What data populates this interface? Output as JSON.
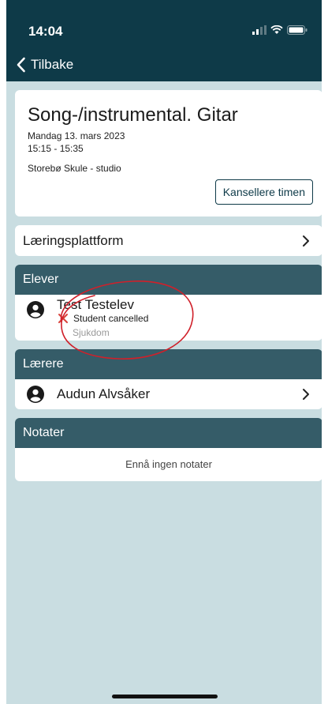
{
  "status_bar": {
    "time": "14:04"
  },
  "nav": {
    "back_label": "Tilbake"
  },
  "lesson": {
    "title": "Song-/instrumental. Gitar",
    "date": "Mandag 13. mars 2023",
    "time": "15:15 - 15:35",
    "location": "Storebø Skule - studio",
    "cancel_button": "Kansellere timen"
  },
  "platform": {
    "label": "Læringsplattform"
  },
  "students": {
    "heading": "Elever",
    "items": [
      {
        "name": "Test Testelev",
        "status": "Student cancelled",
        "reason": "Sjukdom"
      }
    ]
  },
  "teachers": {
    "heading": "Lærere",
    "items": [
      {
        "name": "Audun Alvsåker"
      }
    ]
  },
  "notes": {
    "heading": "Notater",
    "empty_text": "Ennå ingen notater"
  },
  "colors": {
    "header": "#0e3a48",
    "section_header": "#355c68",
    "background": "#c9dde1",
    "cancel_red": "#d9413a",
    "annotation": "#d0202a"
  },
  "icons": [
    "chevron-left-icon",
    "signal-icon",
    "wifi-icon",
    "battery-icon",
    "chevron-right-icon",
    "user-avatar-icon",
    "cross-icon"
  ]
}
